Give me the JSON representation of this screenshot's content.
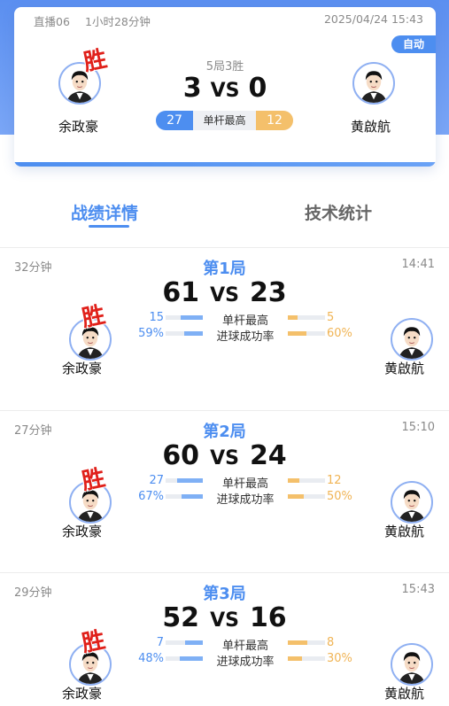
{
  "header": {
    "room": "直播06",
    "duration": "1小时28分钟",
    "datetime": "2025/04/24 15:43",
    "auto_label": "自动"
  },
  "match": {
    "format": "5局3胜",
    "left_score": "3",
    "vs": "VS",
    "right_score": "0",
    "left_player": "余政豪",
    "right_player": "黄啟航",
    "win_stamp": "胜",
    "compare": {
      "left": "27",
      "label": "单杆最高",
      "right": "12"
    }
  },
  "tabs": {
    "active": "战绩详情",
    "inactive": "技术统计"
  },
  "stat_labels": {
    "highest_break": "单杆最高",
    "pot_rate": "进球成功率"
  },
  "games": [
    {
      "title": "第1局",
      "duration": "32分钟",
      "time": "14:41",
      "left_score": "61",
      "vs": "VS",
      "right_score": "23",
      "left_player": "余政豪",
      "right_player": "黄啟航",
      "win_stamp": "胜",
      "break_left": "15",
      "break_right": "5",
      "break_left_fill": 0.6,
      "break_right_fill": 0.25,
      "rate_left": "59%",
      "rate_right": "60%",
      "rate_left_fill": 0.5,
      "rate_right_fill": 0.5
    },
    {
      "title": "第2局",
      "duration": "27分钟",
      "time": "15:10",
      "left_score": "60",
      "vs": "VS",
      "right_score": "24",
      "left_player": "余政豪",
      "right_player": "黄啟航",
      "win_stamp": "胜",
      "break_left": "27",
      "break_right": "12",
      "break_left_fill": 0.7,
      "break_right_fill": 0.3,
      "rate_left": "67%",
      "rate_right": "50%",
      "rate_left_fill": 0.57,
      "rate_right_fill": 0.43
    },
    {
      "title": "第3局",
      "duration": "29分钟",
      "time": "15:43",
      "left_score": "52",
      "vs": "VS",
      "right_score": "16",
      "left_player": "余政豪",
      "right_player": "黄啟航",
      "win_stamp": "胜",
      "break_left": "7",
      "break_right": "8",
      "break_left_fill": 0.47,
      "break_right_fill": 0.53,
      "rate_left": "48%",
      "rate_right": "30%",
      "rate_left_fill": 0.62,
      "rate_right_fill": 0.38
    }
  ],
  "colors": {
    "accent": "#4d8ef0",
    "secondary": "#f4c06b",
    "win": "#e0201a"
  }
}
